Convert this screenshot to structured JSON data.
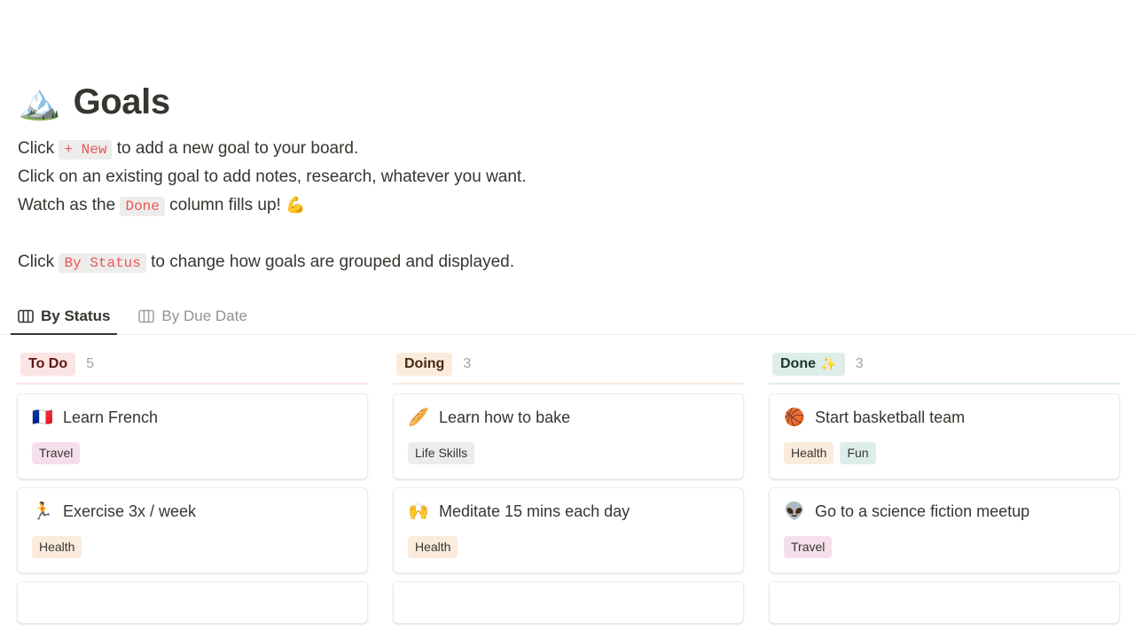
{
  "page": {
    "title": "Goals",
    "title_emoji": "🏔️",
    "description_lines": [
      {
        "parts": [
          {
            "type": "text",
            "value": "Click "
          },
          {
            "type": "code",
            "value": "+ New"
          },
          {
            "type": "text",
            "value": " to add a new goal to your board."
          }
        ]
      },
      {
        "parts": [
          {
            "type": "text",
            "value": "Click on an existing goal to add notes, research, whatever you want."
          }
        ]
      },
      {
        "parts": [
          {
            "type": "text",
            "value": "Watch as the "
          },
          {
            "type": "code",
            "value": "Done"
          },
          {
            "type": "text",
            "value": " column fills up! "
          },
          {
            "type": "emoji",
            "value": "💪"
          }
        ]
      },
      {
        "parts": []
      },
      {
        "parts": [
          {
            "type": "text",
            "value": "Click "
          },
          {
            "type": "code",
            "value": "By Status"
          },
          {
            "type": "text",
            "value": " to change how goals are grouped and displayed."
          }
        ]
      }
    ]
  },
  "tabs": [
    {
      "label": "By Status",
      "icon": "board-view-icon",
      "active": true
    },
    {
      "label": "By Due Date",
      "icon": "board-view-icon",
      "active": false
    }
  ],
  "colors": {
    "todo_badge_bg": "#FBE4E4",
    "todo_badge_text": "#5D1715",
    "doing_badge_bg": "#FAEBDD",
    "doing_badge_text": "#49290E",
    "done_badge_bg": "#DDEDEA",
    "done_badge_text": "#1C3829",
    "tag_travel_bg": "#F4DFEB",
    "tag_health_bg": "#FAEBDD",
    "tag_fun_bg": "#DDEDEA",
    "tag_lifeskills_bg": "#EBECED",
    "rule_todo": "#FBE4E4",
    "rule_doing": "#FAEBDD",
    "rule_done": "#DDEDEA",
    "inline_code_text": "#EB5757"
  },
  "board": {
    "columns": [
      {
        "status": "To Do",
        "status_emoji": "",
        "count": "5",
        "badge_bg": "#FBE4E4",
        "badge_text": "#5D1715",
        "rule": "#FBE4E4",
        "cards": [
          {
            "emoji": "🇫🇷",
            "title": "Learn French",
            "tags": [
              {
                "label": "Travel",
                "bg": "#F4DFEB"
              }
            ]
          },
          {
            "emoji": "🏃",
            "title": "Exercise 3x / week",
            "tags": [
              {
                "label": "Health",
                "bg": "#FAEBDD"
              }
            ]
          },
          {
            "emoji": "",
            "title": "",
            "tags": []
          }
        ]
      },
      {
        "status": "Doing",
        "status_emoji": "",
        "count": "3",
        "badge_bg": "#FAEBDD",
        "badge_text": "#49290E",
        "rule": "#FAEBDD",
        "cards": [
          {
            "emoji": "🥖",
            "title": "Learn how to bake",
            "tags": [
              {
                "label": "Life Skills",
                "bg": "#EBECED"
              }
            ]
          },
          {
            "emoji": "🙌",
            "title": "Meditate 15 mins each day",
            "tags": [
              {
                "label": "Health",
                "bg": "#FAEBDD"
              }
            ]
          },
          {
            "emoji": "",
            "title": "",
            "tags": []
          }
        ]
      },
      {
        "status": "Done",
        "status_emoji": "✨",
        "count": "3",
        "badge_bg": "#DDEDEA",
        "badge_text": "#1C3829",
        "rule": "#DDEDEA",
        "cards": [
          {
            "emoji": "🏀",
            "title": "Start basketball team",
            "tags": [
              {
                "label": "Health",
                "bg": "#FAEBDD"
              },
              {
                "label": "Fun",
                "bg": "#DDEDEA"
              }
            ]
          },
          {
            "emoji": "👽",
            "title": "Go to a science fiction meetup",
            "tags": [
              {
                "label": "Travel",
                "bg": "#F4DFEB"
              }
            ]
          },
          {
            "emoji": "",
            "title": "",
            "tags": []
          }
        ]
      }
    ]
  }
}
